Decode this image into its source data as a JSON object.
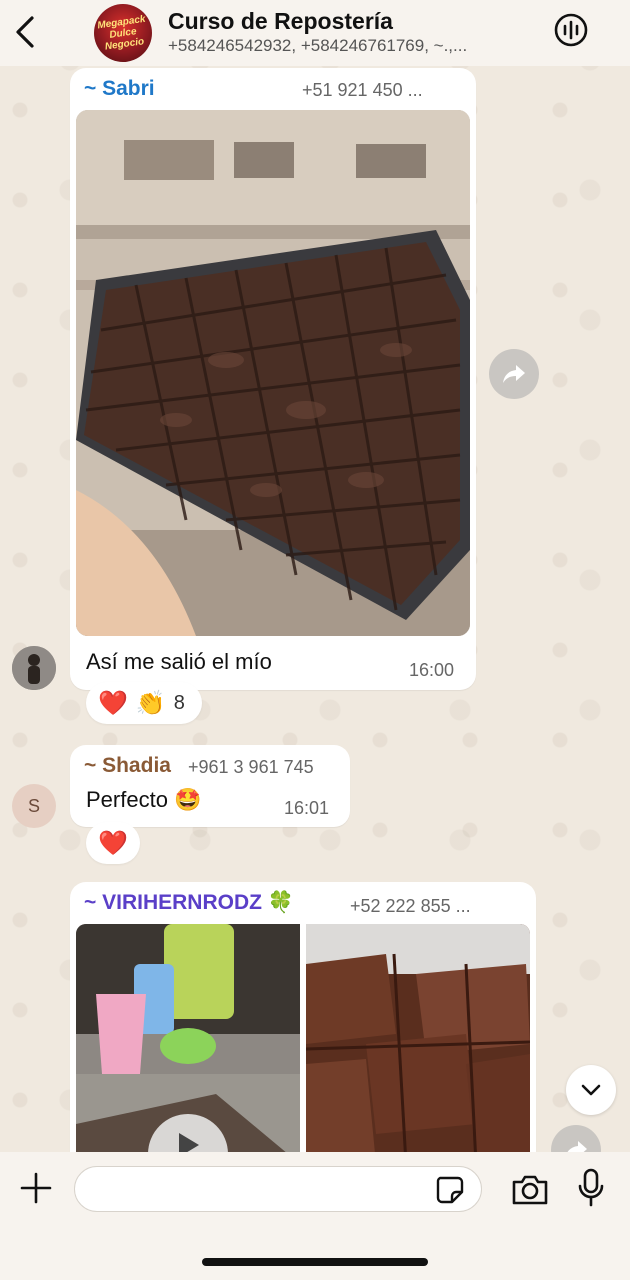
{
  "header": {
    "title": "Curso de Repostería",
    "members": "+584246542932, +584246761769, ~.,...",
    "avatar_text_line1": "Megapack",
    "avatar_text_line2": "Dulce Negocio"
  },
  "messages": [
    {
      "sender": "~ Sabri",
      "sender_color": "#1f78c8",
      "phone": "+51 921 450 ...",
      "image_description": "brownies-tray-photo",
      "text": "Así me salió el mío",
      "time": "16:00",
      "reactions": [
        {
          "emoji": "❤️"
        },
        {
          "emoji": "👏"
        }
      ],
      "reaction_count": "8"
    },
    {
      "sender": "~ Shadia",
      "sender_color": "#8a5a36",
      "phone": "+961 3 961 745",
      "avatar_initial": "S",
      "text": "Perfecto 🤩",
      "time": "16:01",
      "reactions": [
        {
          "emoji": "❤️"
        }
      ]
    },
    {
      "sender": "~ VIRIHERNRODZ 🍀",
      "sender_color": "#5a3fc8",
      "phone": "+52 222 855 ...",
      "images": [
        "video-thumbnail",
        "brownies-closeup-photo"
      ]
    }
  ],
  "input": {
    "placeholder": ""
  },
  "colors": {
    "header_bg": "#f7f3ee",
    "chat_bg": "#f0e9df",
    "bubble_bg": "#ffffff"
  },
  "icons": [
    "back-arrow-icon",
    "voice-call-icon",
    "forward-icon",
    "chevron-down-icon",
    "plus-icon",
    "sticker-icon",
    "camera-icon",
    "microphone-icon",
    "play-icon"
  ]
}
